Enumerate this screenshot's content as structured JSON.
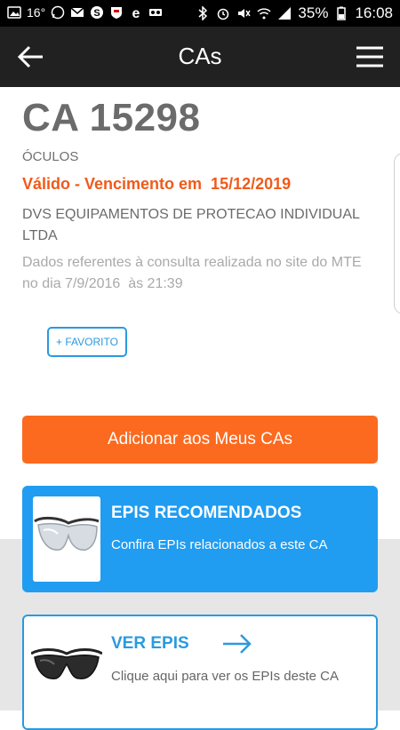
{
  "status_bar": {
    "temperature": "16°",
    "battery": "35%",
    "time": "16:08",
    "icons_left": [
      "image-icon",
      "whatsapp-icon",
      "gmail-icon",
      "skype-icon",
      "shield-app-icon",
      "edge-icon",
      "voicemail-icon"
    ],
    "icons_right": [
      "bluetooth-icon",
      "alarm-icon",
      "mute-icon",
      "wifi-icon",
      "signal-icon",
      "battery-icon"
    ]
  },
  "app_bar": {
    "title": "CAs"
  },
  "ca": {
    "title": "CA 15298",
    "category": "ÓCULOS",
    "validity": "Válido - Vencimento em  15/12/2019",
    "company": "DVS EQUIPAMENTOS DE PROTECAO INDIVIDUAL LTDA",
    "consult_note": "Dados referentes à consulta realizada no site do MTE no dia 7/9/2016  às 21:39"
  },
  "actions": {
    "favorite_label": "+ FAVORITO",
    "add_label": "Adicionar aos Meus CAs"
  },
  "cards": {
    "recommended_title": "EPIS RECOMENDADOS",
    "recommended_sub": "Confira EPIs relacionados a este CA",
    "view_title": "VER EPIS",
    "view_sub": "Clique aqui para ver os EPIs deste CA"
  },
  "colors": {
    "accent_orange": "#fc6a1f",
    "validity_orange": "#f05a1a",
    "accent_blue": "#209cf0",
    "app_bar": "#212121"
  }
}
